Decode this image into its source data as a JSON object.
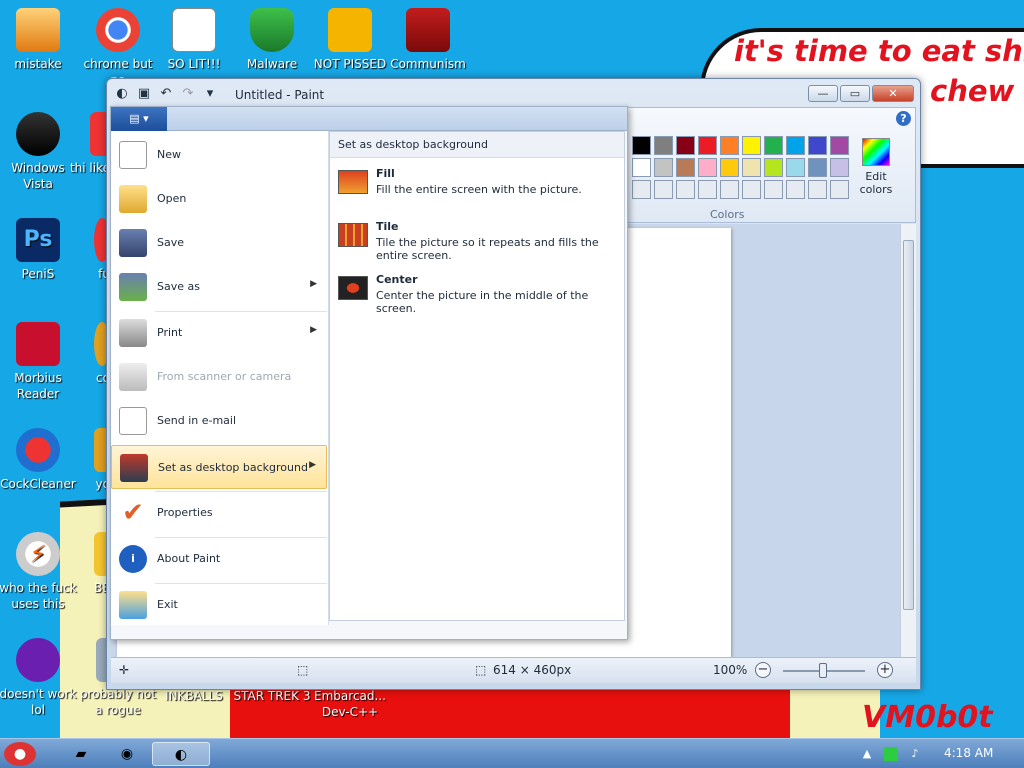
{
  "desktop": {
    "bubble_line1": "it's time to eat shit",
    "bubble_line2": "chew",
    "watermark": "VM0b0t",
    "icons": [
      {
        "label": "mistake"
      },
      {
        "label": "chrome but no"
      },
      {
        "label": "SO LIT!!!"
      },
      {
        "label": "Malware"
      },
      {
        "label": "NOT PISSED"
      },
      {
        "label": "Communism"
      },
      {
        "label": "Windows Vista"
      },
      {
        "label": "thi like"
      },
      {
        "label": "PeniS"
      },
      {
        "label": "fu"
      },
      {
        "label": "Morbius Reader"
      },
      {
        "label": "co"
      },
      {
        "label": "CockCleaner"
      },
      {
        "label": "yo"
      },
      {
        "label": "who the fuck uses this"
      },
      {
        "label": "BE"
      },
      {
        "label": "doesn't work lol"
      },
      {
        "label": "probably not a rogue"
      },
      {
        "label": "INKBALLS"
      },
      {
        "label": "STAR TREK 3"
      },
      {
        "label": "Embarcad... Dev-C++"
      }
    ]
  },
  "window": {
    "title": "Untitled - Paint",
    "controls": {
      "minimize": "—",
      "maximize": "▭",
      "close": "✕"
    },
    "help": "?"
  },
  "ribbon": {
    "colors_label": "Colors",
    "edit_colors": "Edit colors",
    "palette_row1": [
      "#000000",
      "#7f7f7f",
      "#880015",
      "#ed1c24",
      "#ff7f27",
      "#fff200",
      "#22b14c",
      "#00a2e8",
      "#3f48cc",
      "#a349a4"
    ],
    "palette_row2": [
      "#ffffff",
      "#c3c3c3",
      "#b97a57",
      "#ffaec9",
      "#ffc90e",
      "#efe4b0",
      "#b5e61d",
      "#99d9ea",
      "#7092be",
      "#c8bfe7"
    ],
    "palette_row3": [
      "#e6ebf1",
      "#e6ebf1",
      "#e6ebf1",
      "#e6ebf1",
      "#e6ebf1",
      "#e6ebf1",
      "#e6ebf1",
      "#e6ebf1",
      "#e6ebf1",
      "#e6ebf1"
    ]
  },
  "file_menu": {
    "items": [
      {
        "label": "New",
        "arrow": ""
      },
      {
        "label": "Open",
        "arrow": ""
      },
      {
        "label": "Save",
        "arrow": ""
      },
      {
        "label": "Save as",
        "arrow": "▶"
      },
      {
        "label": "Print",
        "arrow": "▶"
      },
      {
        "label": "From scanner or camera",
        "arrow": ""
      },
      {
        "label": "Send in e-mail",
        "arrow": ""
      },
      {
        "label": "Set as desktop background",
        "arrow": "▶"
      },
      {
        "label": "Properties",
        "arrow": ""
      },
      {
        "label": "About Paint",
        "arrow": ""
      },
      {
        "label": "Exit",
        "arrow": ""
      }
    ],
    "submenu": {
      "header": "Set as desktop background",
      "options": [
        {
          "title": "Fill",
          "desc": "Fill the entire screen with the picture."
        },
        {
          "title": "Tile",
          "desc": "Tile the picture so it repeats and fills the entire screen."
        },
        {
          "title": "Center",
          "desc": "Center the picture in the middle of the screen."
        }
      ]
    }
  },
  "status": {
    "dimensions": "614 × 460px",
    "zoom": "100%",
    "zoom_out": "−",
    "zoom_in": "+"
  },
  "taskbar": {
    "clock": "4:18 AM"
  }
}
